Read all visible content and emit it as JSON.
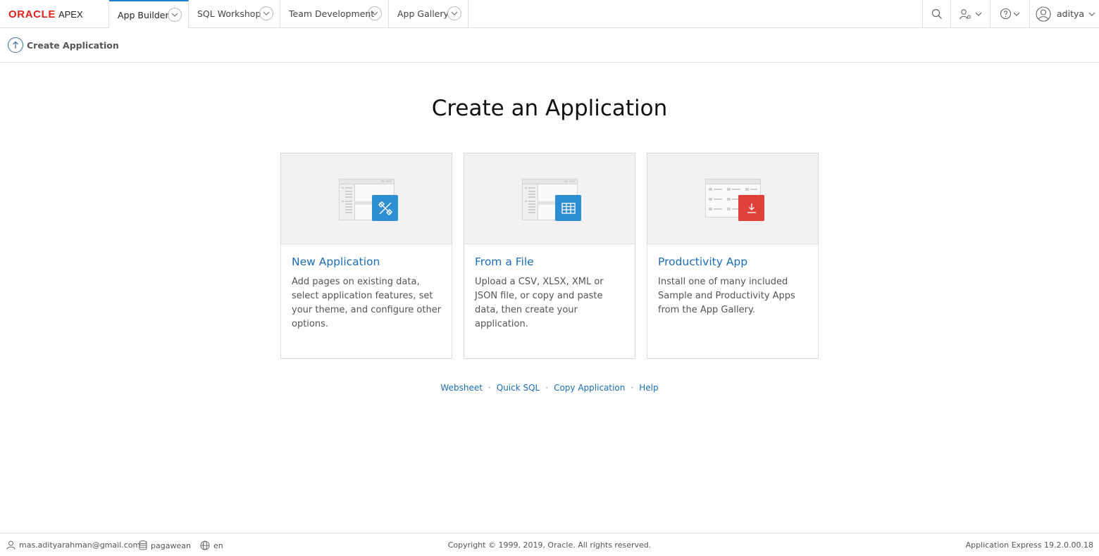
{
  "brand": {
    "oracle": "ORACLE",
    "apex": "APEX"
  },
  "nav": {
    "tabs": [
      {
        "label": "App Builder",
        "active": true
      },
      {
        "label": "SQL Workshop",
        "active": false
      },
      {
        "label": "Team Development",
        "active": false
      },
      {
        "label": "App Gallery",
        "active": false
      }
    ],
    "user": "aditya"
  },
  "breadcrumb": {
    "title": "Create Application"
  },
  "main": {
    "title": "Create an Application",
    "cards": [
      {
        "title": "New Application",
        "description": "Add pages on existing data, select application features, set your theme, and configure other options.",
        "icon": "wrench-ruler-icon",
        "color": "#2d8ed3"
      },
      {
        "title": "From a File",
        "description": "Upload a CSV, XLSX, XML or JSON file, or copy and paste data, then create your application.",
        "icon": "table-grid-icon",
        "color": "#2d8ed3"
      },
      {
        "title": "Productivity App",
        "description": "Install one of many included Sample and Productivity Apps from the App Gallery.",
        "icon": "download-icon",
        "color": "#e0403a"
      }
    ],
    "links": [
      "Websheet",
      "Quick SQL",
      "Copy Application",
      "Help"
    ]
  },
  "footer": {
    "email": "mas.adityarahman@gmail.com",
    "workspace": "pagawean",
    "language": "en",
    "copyright": "Copyright © 1999, 2019, Oracle. All rights reserved.",
    "version": "Application Express 19.2.0.00.18"
  }
}
